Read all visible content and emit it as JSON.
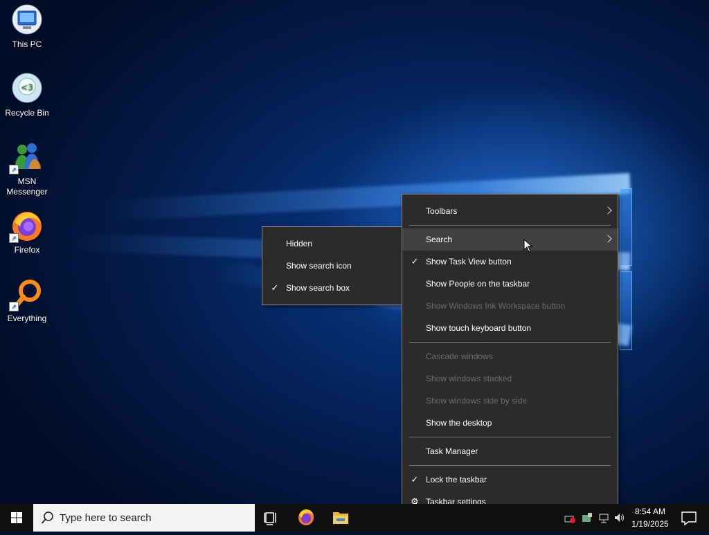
{
  "desktop": {
    "icons": [
      {
        "label": "This PC"
      },
      {
        "label": "Recycle Bin"
      },
      {
        "label": "MSN Messenger"
      },
      {
        "label": "Firefox"
      },
      {
        "label": "Everything"
      }
    ]
  },
  "context_menu": {
    "items": {
      "toolbars": "Toolbars",
      "search": "Search",
      "show_task_view": "Show Task View button",
      "show_people": "Show People on the taskbar",
      "show_ink": "Show Windows Ink Workspace button",
      "show_touch_keyboard": "Show touch keyboard button",
      "cascade": "Cascade windows",
      "stacked": "Show windows stacked",
      "side_by_side": "Show windows side by side",
      "show_desktop": "Show the desktop",
      "task_manager": "Task Manager",
      "lock_taskbar": "Lock the taskbar",
      "taskbar_settings": "Taskbar settings"
    }
  },
  "search_submenu": {
    "hidden": "Hidden",
    "show_icon": "Show search icon",
    "show_box": "Show search box"
  },
  "taskbar": {
    "search_placeholder": "Type here to search",
    "time": "8:54 AM",
    "date": "1/19/2025"
  },
  "colors": {
    "menu_bg": "#2b2b2b",
    "menu_hover": "#414141",
    "disabled_text": "#6d6d6d",
    "taskbar_bg": "#101010"
  }
}
